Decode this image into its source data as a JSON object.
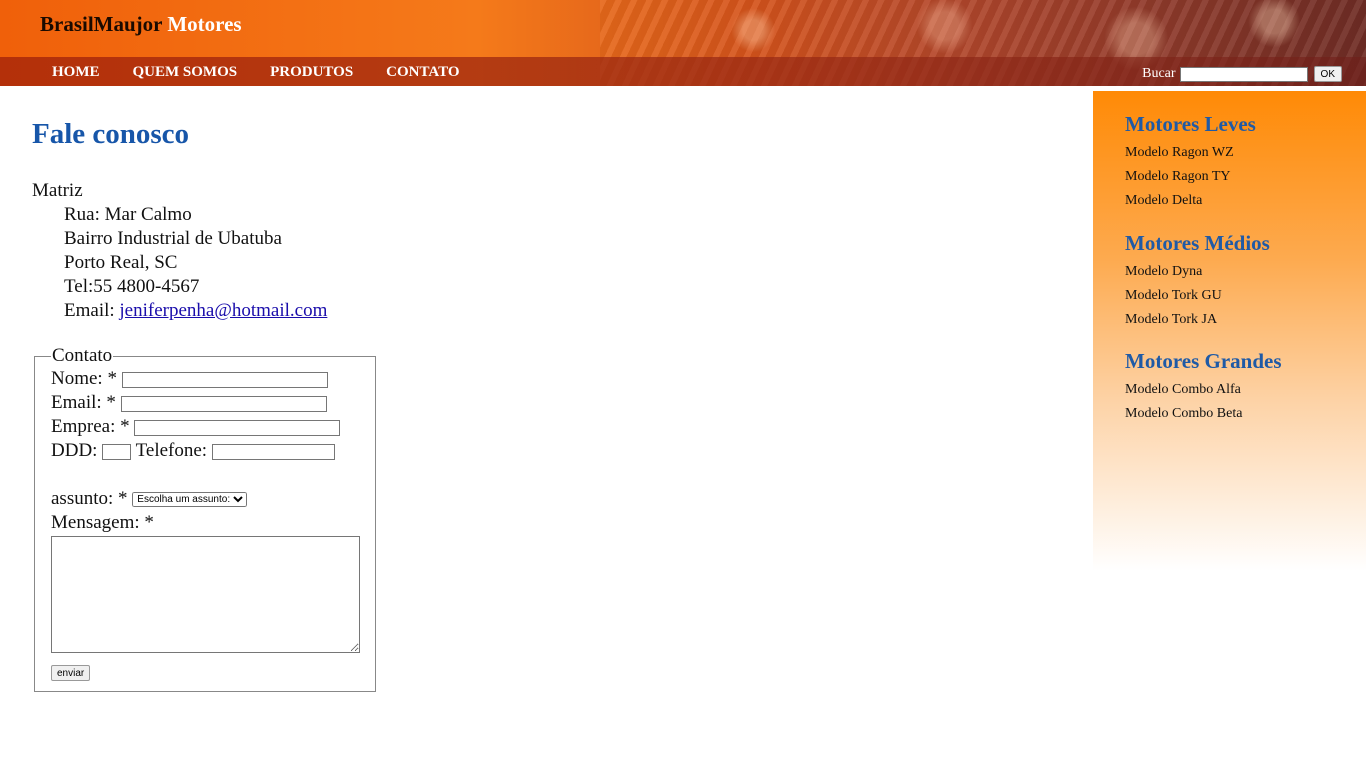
{
  "brand": {
    "part1": "BrasilMaujor",
    "part2": "Motores"
  },
  "nav": [
    "HOME",
    "QUEM SOMOS",
    "PRODUTOS",
    "CONTATO"
  ],
  "search": {
    "label": "Bucar",
    "value": "",
    "button": "OK"
  },
  "page": {
    "title": "Fale conosco",
    "address": {
      "heading": "Matriz",
      "street": "Rua: Mar Calmo",
      "district": "Bairro Industrial de Ubatuba",
      "city": "Porto Real, SC",
      "phone": "Tel:55 4800-4567",
      "email_label": "Email: ",
      "email": "jeniferpenha@hotmail.com"
    }
  },
  "form": {
    "legend": "Contato",
    "nome_label": "Nome: *",
    "email_label": "Email: *",
    "empresa_label": "Emprea: *",
    "ddd_label": "DDD:",
    "telefone_label": "Telefone:",
    "assunto_label": "assunto: *",
    "assunto_selected": "Escolha um assunto:",
    "mensagem_label": "Mensagem: *",
    "submit": "enviar"
  },
  "sidebar": {
    "groups": [
      {
        "title": "Motores Leves",
        "items": [
          "Modelo Ragon WZ",
          "Modelo Ragon TY",
          "Modelo Delta"
        ]
      },
      {
        "title": "Motores Médios",
        "items": [
          "Modelo Dyna",
          "Modelo Tork GU",
          "Modelo Tork JA"
        ]
      },
      {
        "title": "Motores Grandes",
        "items": [
          "Modelo Combo Alfa",
          "Modelo Combo Beta"
        ]
      }
    ]
  },
  "colors": {
    "accent": "#1756a9",
    "header_orange": "#f0600a",
    "sidebar_orange": "#ff8a06"
  }
}
